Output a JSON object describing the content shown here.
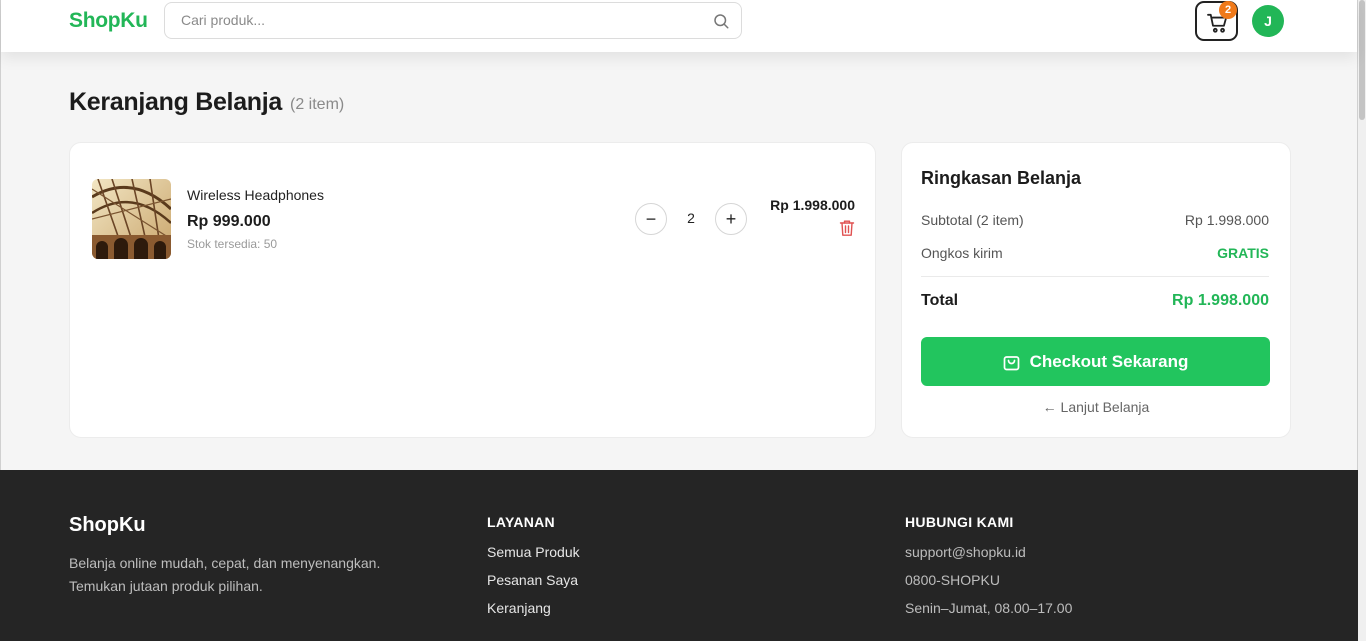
{
  "header": {
    "logo": "ShopKu",
    "search_placeholder": "Cari produk...",
    "cart_badge": "2",
    "avatar_initial": "J"
  },
  "page": {
    "title": "Keranjang Belanja",
    "item_count": "(2 item)"
  },
  "cart": {
    "items": [
      {
        "name": "Wireless Headphones",
        "price": "Rp 999.000",
        "stock": "Stok tersedia: 50",
        "quantity": "2",
        "line_total": "Rp 1.998.000"
      }
    ],
    "minus_label": "−",
    "plus_label": "+"
  },
  "summary": {
    "title": "Ringkasan Belanja",
    "subtotal_label": "Subtotal (2 item)",
    "subtotal_value": "Rp 1.998.000",
    "shipping_label": "Ongkos kirim",
    "shipping_value": "GRATIS",
    "total_label": "Total",
    "total_value": "Rp 1.998.000",
    "checkout_label": "Checkout Sekarang",
    "continue_label": "← Lanjut Belanja"
  },
  "footer": {
    "logo": "ShopKu",
    "description_line1": "Belanja online mudah, cepat, dan menyenangkan.",
    "description_line2": "Temukan jutaan produk pilihan.",
    "services_heading": "LAYANAN",
    "services": [
      "Semua Produk",
      "Pesanan Saya",
      "Keranjang"
    ],
    "contact_heading": "HUBUNGI KAMI",
    "contact": [
      "support@shopku.id",
      "0800-SHOPKU",
      "Senin–Jumat, 08.00–17.00"
    ]
  },
  "colors": {
    "brand": "#22b657",
    "checkout": "#22c55e",
    "badge": "#f07a1a",
    "delete": "#e05252",
    "footer_bg": "#252525"
  },
  "icons": {
    "search": "search-icon",
    "cart": "cart-icon",
    "delete": "trash-icon",
    "checkout": "shopping-bag-icon"
  }
}
